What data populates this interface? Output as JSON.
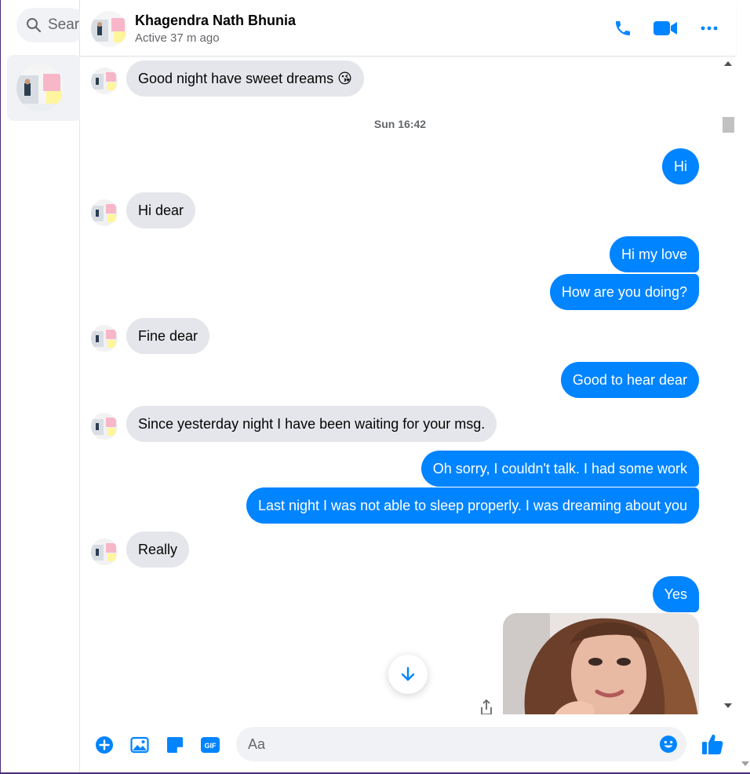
{
  "colors": {
    "accent": "#0084ff",
    "incoming_bubble": "#e4e6eb",
    "outgoing_text": "#ffffff"
  },
  "sidebar": {
    "search": {
      "placeholder": "Search Messenger"
    }
  },
  "header": {
    "contact_name": "Khagendra Nath Bhunia",
    "status": "Active 37 m ago",
    "icons": [
      "phone-icon",
      "video-icon",
      "more-icon"
    ]
  },
  "conversation": {
    "timestamp": "Sun 16:42",
    "messages": [
      {
        "from": "them",
        "text": "Good night have sweet dreams 😘"
      },
      {
        "from": "me",
        "text": "Hi"
      },
      {
        "from": "them",
        "text": "Hi dear"
      },
      {
        "from": "me",
        "text": "Hi my love"
      },
      {
        "from": "me",
        "text": "How are you doing?"
      },
      {
        "from": "them",
        "text": "Fine dear"
      },
      {
        "from": "me",
        "text": "Good to hear dear"
      },
      {
        "from": "them",
        "text": "Since yesterday night I have been waiting for your msg."
      },
      {
        "from": "me",
        "text": "Oh sorry, I couldn't talk. I had some work"
      },
      {
        "from": "me",
        "text": "Last night I was not able to sleep properly. I was dreaming about you"
      },
      {
        "from": "them",
        "text": "Really"
      },
      {
        "from": "me",
        "text": "Yes"
      }
    ]
  },
  "composer": {
    "placeholder": "Aa",
    "gif_label": "GIF",
    "icons": [
      "plus-icon",
      "image-icon",
      "sticker-icon",
      "gif-icon",
      "emoji-icon",
      "thumbs-up-icon"
    ]
  }
}
